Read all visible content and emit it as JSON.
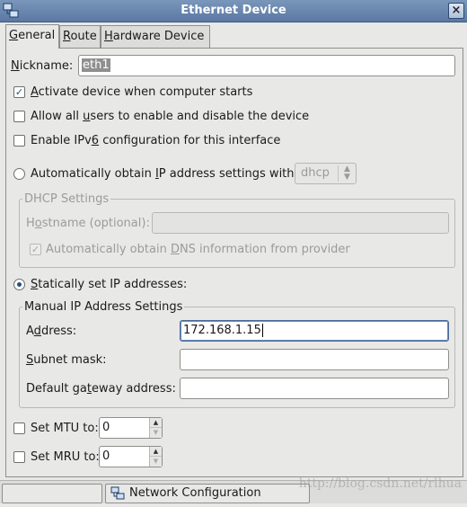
{
  "window": {
    "title": "Ethernet Device",
    "close_glyph": "×"
  },
  "tabs": [
    {
      "label": "General",
      "mnemonic": "G",
      "rest": "eneral",
      "active": true
    },
    {
      "label": "Route",
      "mnemonic": "R",
      "rest": "oute",
      "active": false
    },
    {
      "label": "Hardware Device",
      "mnemonic": "H",
      "rest": "ardware Device",
      "active": false
    }
  ],
  "general": {
    "nickname": {
      "pre": "",
      "mn": "N",
      "post": "ickname:",
      "value": "eth1"
    },
    "activate": {
      "pre": "",
      "mn": "A",
      "post": "ctivate device when computer starts",
      "checked": true
    },
    "allow_users": {
      "pre": "Allow all ",
      "mn": "u",
      "post": "sers to enable and disable the device",
      "checked": false
    },
    "ipv6": {
      "pre": "Enable IPv",
      "mn": "6",
      "post": " configuration for this interface",
      "checked": false
    },
    "auto_obtain": {
      "pre": "Automatically obtain ",
      "mn": "I",
      "post": "P address settings with:",
      "selected": false
    },
    "dhcp_combo_value": "dhcp",
    "dhcp_settings": {
      "title": "DHCP Settings",
      "hostname": {
        "pre": "H",
        "mn": "o",
        "post": "stname (optional):",
        "value": ""
      },
      "auto_dns": {
        "pre": "Automatically obtain ",
        "mn": "D",
        "post": "NS information from provider",
        "checked": true
      }
    },
    "static": {
      "pre": "",
      "mn": "S",
      "post": "tatically set IP addresses:",
      "selected": true
    },
    "manual": {
      "title": "Manual IP Address Settings",
      "address": {
        "pre": "A",
        "mn": "d",
        "post": "dress:",
        "value": "172.168.1.15"
      },
      "subnet": {
        "pre": "",
        "mn": "S",
        "post": "ubnet mask:",
        "value": ""
      },
      "gateway": {
        "pre": "Default ga",
        "mn": "t",
        "post": "eway address:",
        "value": ""
      }
    },
    "mtu": {
      "pre": "Set MTU to:",
      "mn": "",
      "post": "",
      "checked": false,
      "value": "0"
    },
    "mru": {
      "pre": "Set MRU to:",
      "mn": "",
      "post": "",
      "checked": false,
      "value": "0"
    }
  },
  "taskbar": {
    "item": "Network Configuration"
  },
  "watermark": "http://blog.csdn.net/rlhua",
  "icons": {
    "app": "network-device-icon",
    "task": "network-config-icon",
    "check": "✓",
    "spin_up": "▲",
    "spin_down": "▼",
    "combo_arrows": "▲▼"
  },
  "colors": {
    "titlebar": "#5a78a2",
    "background": "#e8e8e7",
    "accent": "#2a4d7e"
  }
}
